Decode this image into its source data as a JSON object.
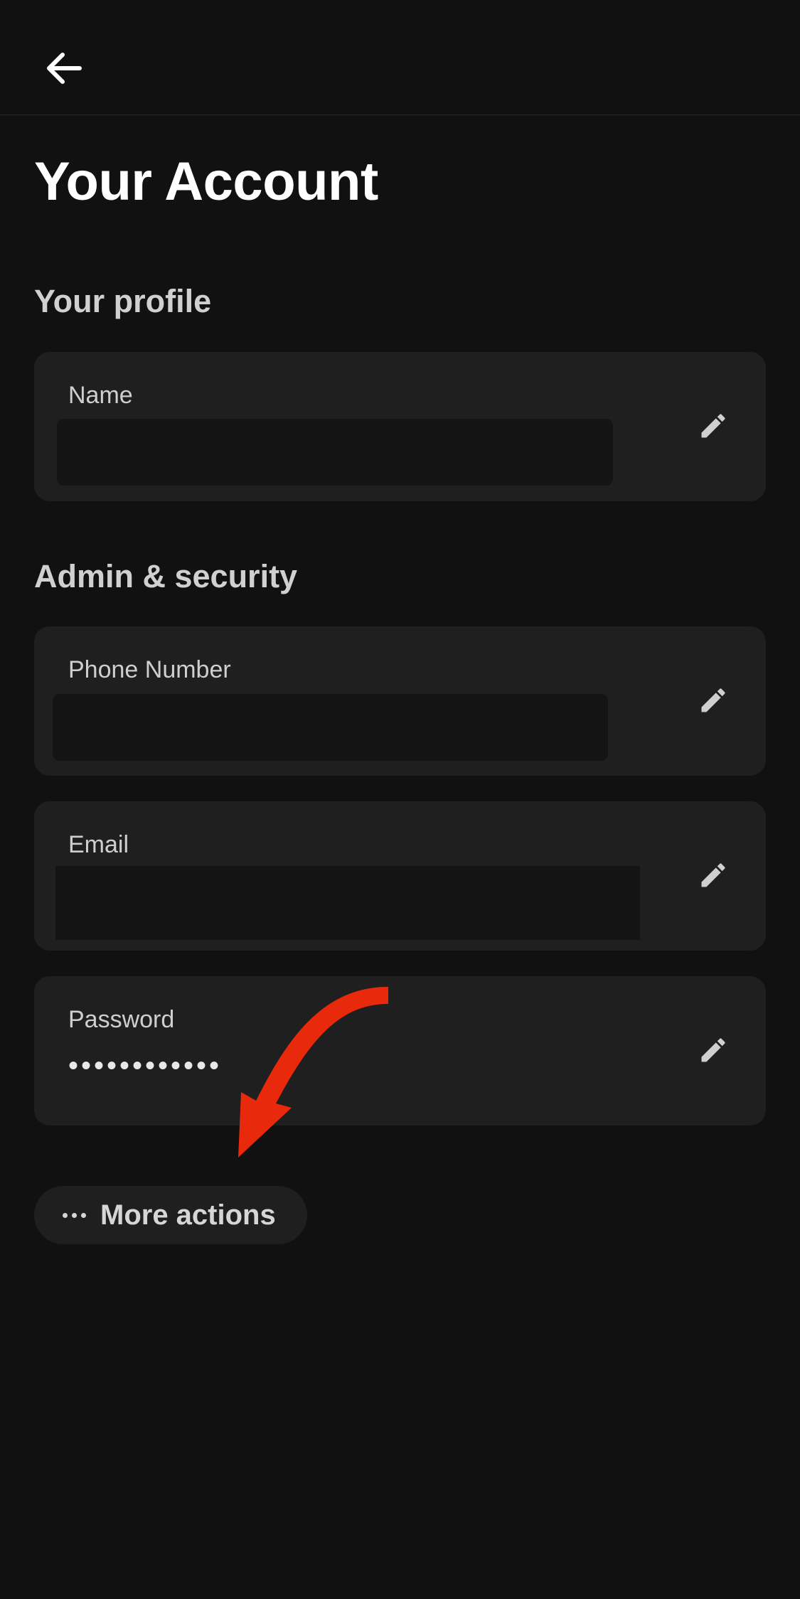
{
  "header": {
    "back_icon": "arrow-left-icon"
  },
  "page": {
    "title": "Your Account"
  },
  "profile_section": {
    "title": "Your profile",
    "fields": [
      {
        "label": "Name",
        "value": "",
        "edit_icon": "pencil-icon"
      }
    ]
  },
  "security_section": {
    "title": "Admin & security",
    "fields": [
      {
        "label": "Phone Number",
        "value": "",
        "edit_icon": "pencil-icon"
      },
      {
        "label": "Email",
        "value": "",
        "edit_icon": "pencil-icon"
      },
      {
        "label": "Password",
        "value": "••••••••••••",
        "edit_icon": "pencil-icon"
      }
    ]
  },
  "more_actions": {
    "icon": "ellipsis-icon",
    "label": "More actions"
  },
  "colors": {
    "background": "#111111",
    "card": "#1f1f1f",
    "annotation_arrow": "#e8290b"
  }
}
